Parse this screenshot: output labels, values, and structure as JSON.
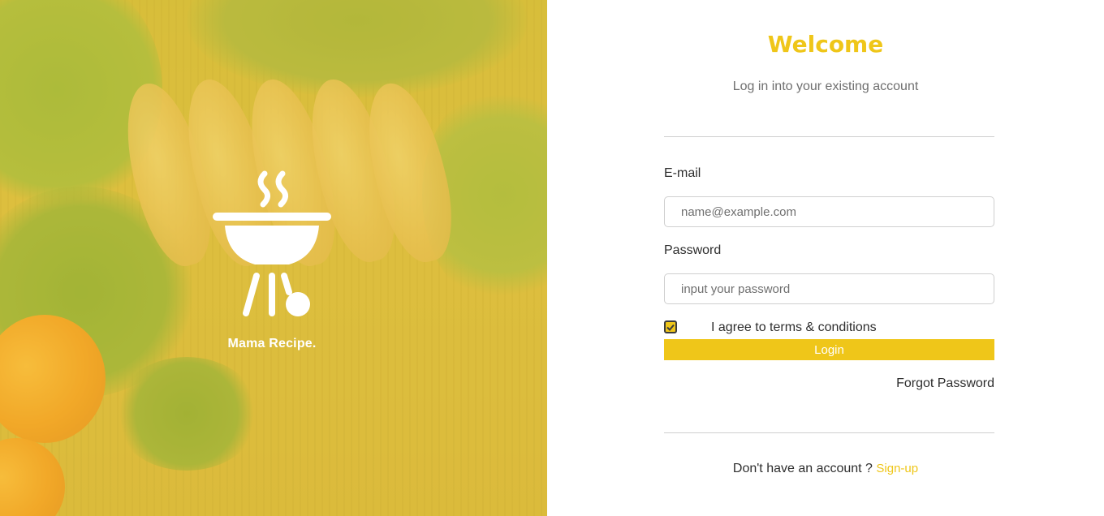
{
  "brand": {
    "name": "Mama Recipe.",
    "logo_icon": "grill-icon"
  },
  "login": {
    "title": "Welcome",
    "subtitle": "Log in into your existing account",
    "email_label": "E-mail",
    "email_placeholder": "name@example.com",
    "password_label": "Password",
    "password_placeholder": "input your password",
    "terms_checked": true,
    "terms_label": "I agree to terms & conditions",
    "login_button": "Login",
    "forgot_password": "Forgot Password",
    "signup_prompt": "Don't have an account ?",
    "signup_link": "Sign-up"
  },
  "colors": {
    "accent": "#efc619",
    "hero_overlay": "#ecc93c",
    "text": "#2e2e2e",
    "muted": "#6f6f6f"
  }
}
